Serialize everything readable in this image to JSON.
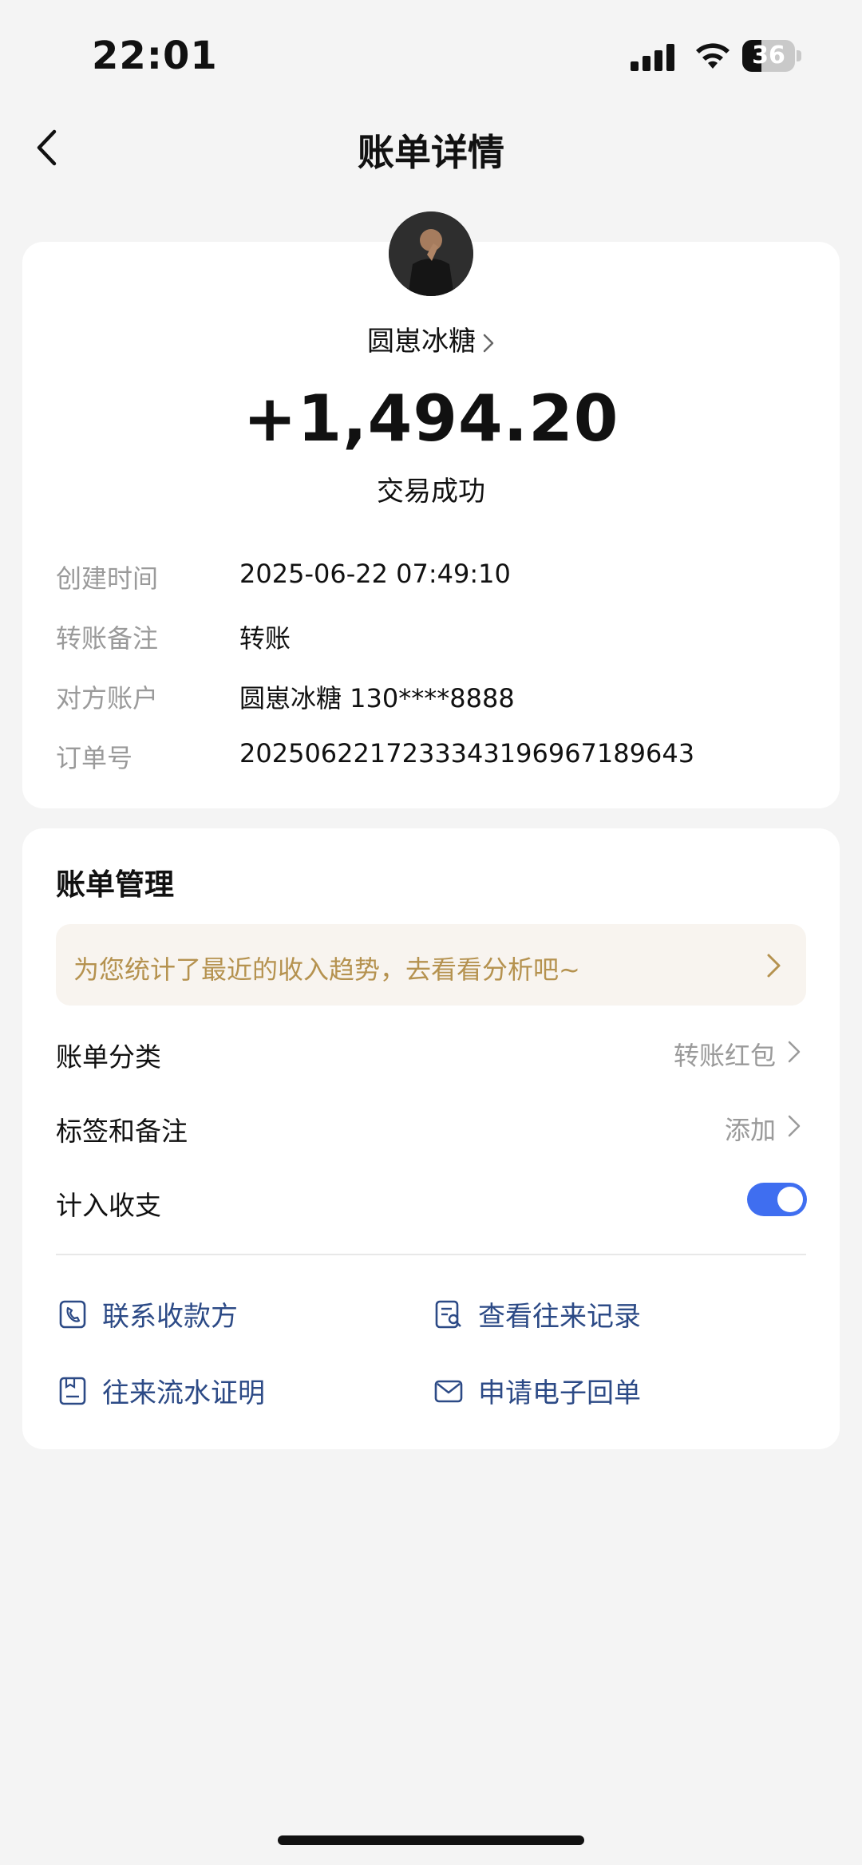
{
  "status_bar": {
    "time": "22:01",
    "battery": "36"
  },
  "nav": {
    "title": "账单详情"
  },
  "summary": {
    "payee": "圆崽冰糖",
    "amount": "+1,494.20",
    "state": "交易成功"
  },
  "details": [
    {
      "label": "创建时间",
      "value": "2025-06-22 07:49:10"
    },
    {
      "label": "转账备注",
      "value": "转账"
    },
    {
      "label": "对方账户",
      "value": "圆崽冰糖 130****8888"
    },
    {
      "label": "订单号",
      "value": "20250622172333431969671896​43"
    }
  ],
  "management": {
    "title": "账单管理",
    "banner": "为您统计了最近的收入趋势，去看看分析吧~",
    "items": [
      {
        "label": "账单分类",
        "value": "转账红包"
      },
      {
        "label": "标签和备注",
        "value": "添加"
      },
      {
        "label": "计入收支",
        "value": ""
      }
    ],
    "include_in_stats": true
  },
  "actions": [
    {
      "label": "联系收款方",
      "icon": "phone-icon"
    },
    {
      "label": "查看往来记录",
      "icon": "record-search-icon"
    },
    {
      "label": "往来流水证明",
      "icon": "document-icon"
    },
    {
      "label": "申请电子回单",
      "icon": "envelope-icon"
    }
  ],
  "colors": {
    "accent": "#3f6ef0",
    "banner_text": "#b5924f",
    "action_text": "#2c4a86"
  }
}
